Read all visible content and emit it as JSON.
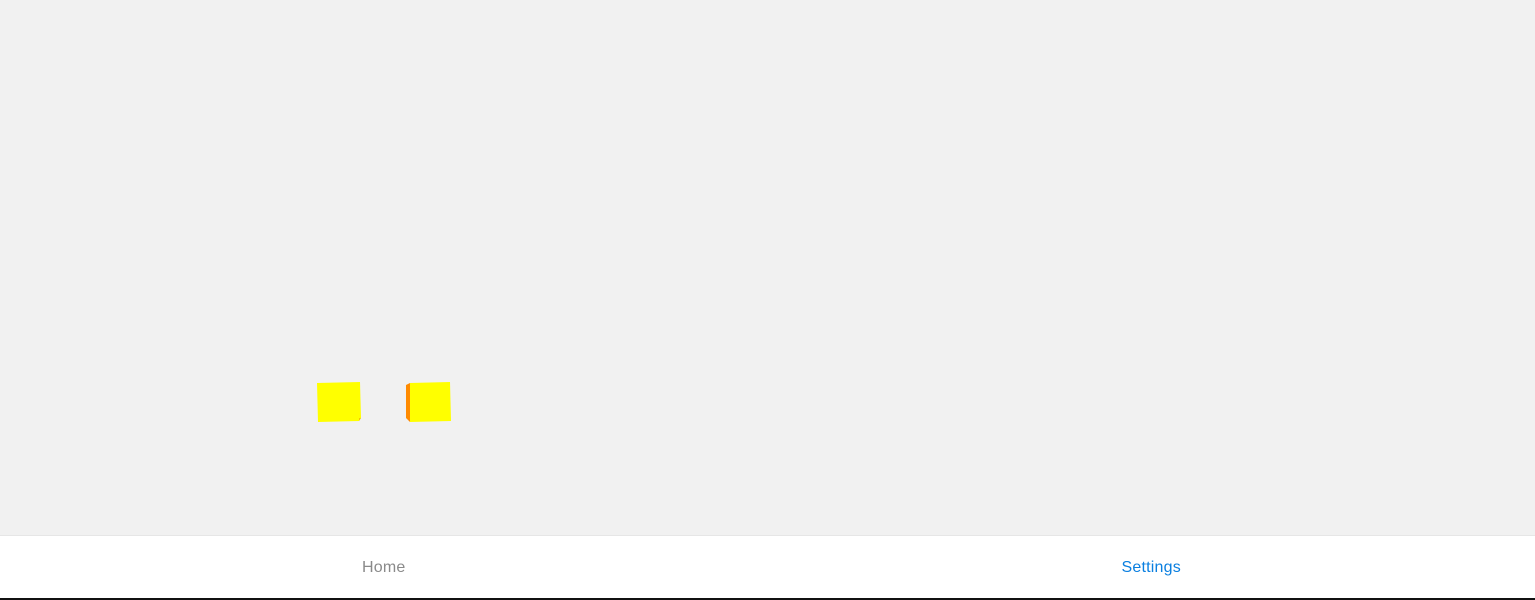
{
  "scene": {
    "objects": [
      {
        "name": "cube-left",
        "face_color": "#ffff00",
        "side_color": "#ffb000"
      },
      {
        "name": "cube-right",
        "face_color": "#ffff00",
        "side_color": "#ff8a00"
      }
    ]
  },
  "tabbar": {
    "tabs": [
      {
        "label": "Home",
        "active": false
      },
      {
        "label": "Settings",
        "active": true
      }
    ],
    "active_color": "#0a7fe0",
    "inactive_color": "#8a8a8a"
  }
}
